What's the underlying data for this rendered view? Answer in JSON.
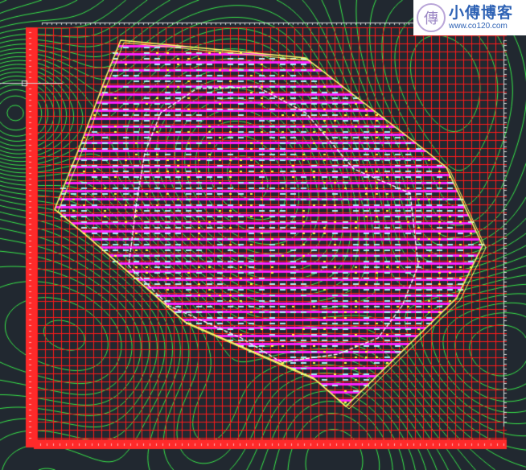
{
  "viewport": {
    "background_color": "#212830",
    "colors": {
      "grid": "#ff1a1a",
      "grid_border": "#ff2a2a",
      "contour": "#38e84a",
      "boundary_outer": "#ffff66",
      "boundary_inner": "#ffffff",
      "dash_cyan": "#a8f0f8",
      "dash_magenta": "#ff20ff",
      "dash_yellow": "#ffff40",
      "ruler": "#d8d8d8"
    }
  },
  "watermark": {
    "logo_glyph": "傳",
    "title": "小傅博客",
    "url": "www.co120.com"
  }
}
